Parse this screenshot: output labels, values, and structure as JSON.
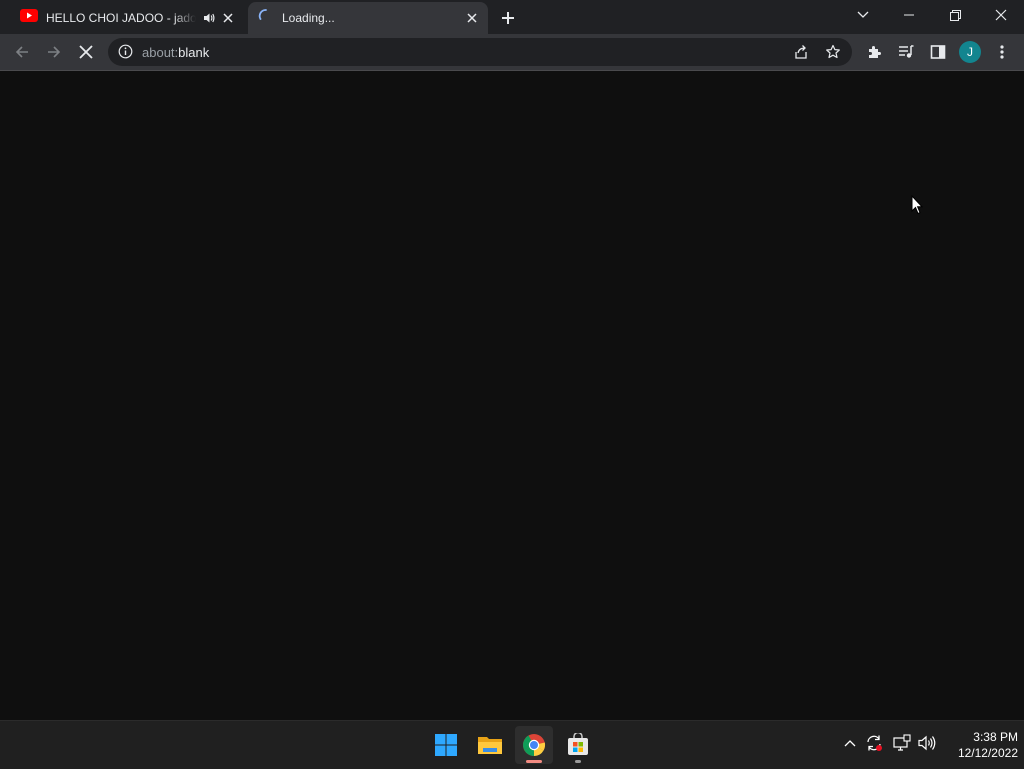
{
  "browser": {
    "tabs": [
      {
        "title": "HELLO CHOI JADOO - jadoo",
        "favicon": "youtube-icon",
        "audio": "speaker-icon",
        "active": false
      },
      {
        "title": "Loading...",
        "favicon": "loading-spinner-icon",
        "active": true
      }
    ],
    "address": {
      "scheme": "about:",
      "path": "blank"
    },
    "profile_initial": "J"
  },
  "taskbar": {
    "apps": [
      "start-icon",
      "file-explorer-icon",
      "chrome-icon",
      "store-icon"
    ],
    "clock": {
      "time": "3:38 PM",
      "date": "12/12/2022"
    }
  },
  "colors": {
    "accent": "#12858f",
    "background": "#0f0f0f",
    "toolbar": "#35363a",
    "tabstrip": "#202124"
  }
}
